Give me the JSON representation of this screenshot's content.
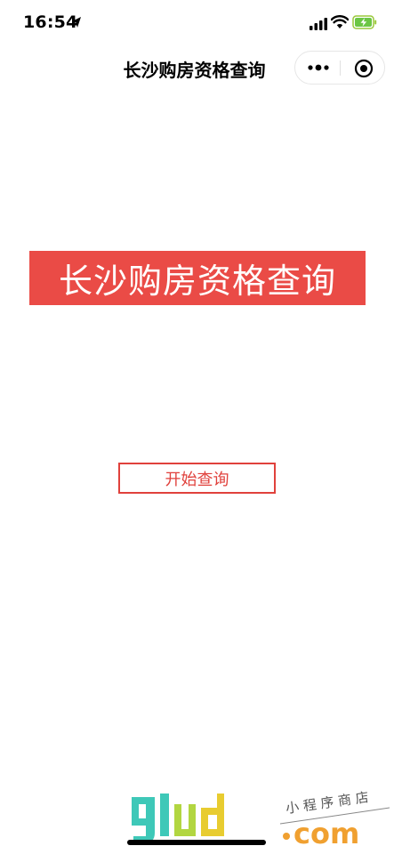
{
  "status_bar": {
    "time": "16:54"
  },
  "nav": {
    "title": "长沙购房资格查询"
  },
  "banner": {
    "text": "长沙购房资格查询"
  },
  "start_button": {
    "label": "开始查询"
  },
  "watermark": {
    "brand": "9lud",
    "suffix": ".com",
    "tagline": "小程序商店"
  },
  "colors": {
    "accent_red": "#ea4b46",
    "button_border": "#e0413c",
    "watermark_teal": "#3ec8b8",
    "watermark_green": "#9ccc3c",
    "watermark_orange": "#f0a030"
  },
  "icons": {
    "location": "location-arrow-icon",
    "signal": "cellular-signal-icon",
    "wifi": "wifi-icon",
    "battery": "battery-charging-icon",
    "more": "more-dots-icon",
    "close": "close-miniprogram-icon"
  }
}
